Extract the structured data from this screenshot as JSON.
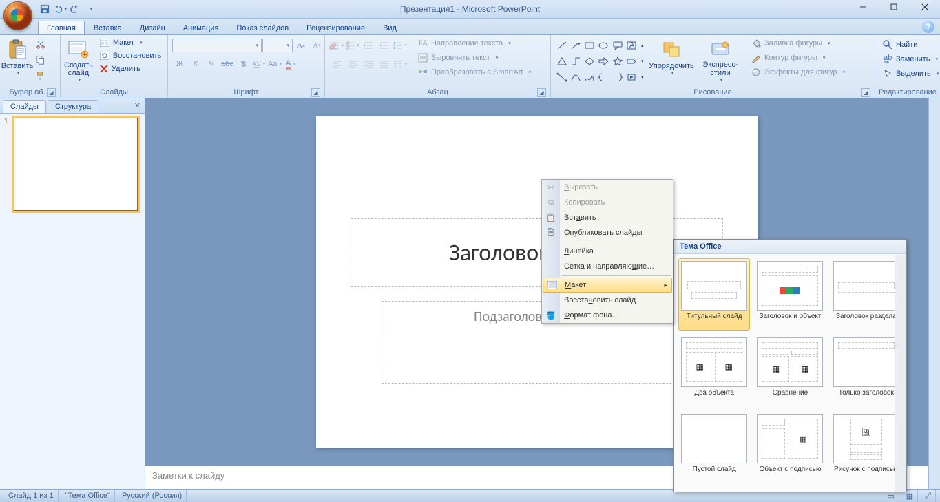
{
  "title": "Презентация1 - Microsoft PowerPoint",
  "tabs": {
    "home": "Главная",
    "insert": "Вставка",
    "design": "Дизайн",
    "anim": "Анимация",
    "show": "Показ слайдов",
    "review": "Рецензирование",
    "view": "Вид"
  },
  "groups": {
    "clipboard": {
      "label": "Буфер об…",
      "paste": "Вставить"
    },
    "slides": {
      "label": "Слайды",
      "new": "Создать\nслайд",
      "layout": "Макет",
      "reset": "Восстановить",
      "delete": "Удалить"
    },
    "font": {
      "label": "Шрифт"
    },
    "para": {
      "label": "Абзац",
      "textdir": "Направление текста",
      "align": "Выровнять текст",
      "smartart": "Преобразовать в SmartArt"
    },
    "draw": {
      "label": "Рисование",
      "arrange": "Упорядочить",
      "styles": "Экспресс-стили",
      "fill": "Заливка фигуры",
      "outline": "Контур фигуры",
      "effects": "Эффекты для фигур"
    },
    "edit": {
      "label": "Редактирование",
      "find": "Найти",
      "replace": "Заменить",
      "select": "Выделить"
    }
  },
  "sidepanel": {
    "slides": "Слайды",
    "outline": "Структура",
    "num": "1"
  },
  "slide": {
    "title": "Заголовок слайда",
    "sub": "Подзаголовок слайда"
  },
  "notes": "Заметки к слайду",
  "status": {
    "slide": "Слайд 1 из 1",
    "theme": "\"Тема Office\"",
    "lang": "Русский (Россия)"
  },
  "ctx": {
    "cut": "Вырезать",
    "copy": "Копировать",
    "paste": "Вставить",
    "publish": "Опубликовать слайды",
    "ruler": "Линейка",
    "grid": "Сетка и направляющие…",
    "layout": "Макет",
    "reset": "Восстановить слайд",
    "format": "Формат фона…"
  },
  "flyout": {
    "hdr": "Тема Office",
    "items": [
      "Титульный слайд",
      "Заголовок и объект",
      "Заголовок раздела",
      "Два объекта",
      "Сравнение",
      "Только заголовок",
      "Пустой слайд",
      "Объект с подписью",
      "Рисунок с подписью"
    ]
  }
}
